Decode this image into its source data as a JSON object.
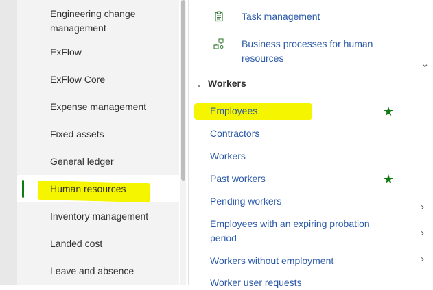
{
  "nav": {
    "items": [
      {
        "label_line1": "Engineering change",
        "label_line2": "management"
      },
      {
        "label": "ExFlow"
      },
      {
        "label": "ExFlow Core"
      },
      {
        "label": "Expense management"
      },
      {
        "label": "Fixed assets"
      },
      {
        "label": "General ledger"
      },
      {
        "label": "Human resources",
        "selected": true
      },
      {
        "label": "Inventory management"
      },
      {
        "label": "Landed cost"
      },
      {
        "label": "Leave and absence"
      }
    ]
  },
  "workspaces": [
    {
      "label": "Task management",
      "icon": "clipboard-icon"
    },
    {
      "label_line1": "Business processes for human",
      "label_line2": "resources",
      "icon": "process-flow-icon"
    }
  ],
  "section": {
    "title": "Workers",
    "links": [
      {
        "label": "Employees",
        "favorite": true
      },
      {
        "label": "Contractors"
      },
      {
        "label": "Workers"
      },
      {
        "label": "Past workers",
        "favorite": true
      },
      {
        "label": "Pending workers"
      },
      {
        "label_line1": "Employees with an expiring probation",
        "label_line2": "period"
      },
      {
        "label": "Workers without employment"
      },
      {
        "label": "Worker user requests"
      }
    ]
  },
  "colors": {
    "accent": "#107c10",
    "link": "#2b5aa8",
    "highlight": "#f5f500"
  }
}
